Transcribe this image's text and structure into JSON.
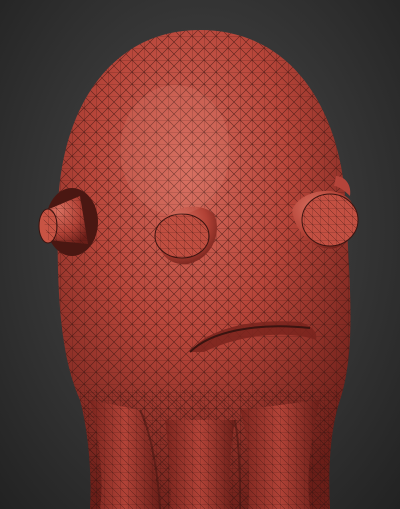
{
  "viewport": {
    "background": "#3a3a3a",
    "model": {
      "name": "creature-mesh",
      "shading": "wireframe-on-shaded",
      "surface_color": "#b8463a",
      "wire_color": "#3a1410"
    }
  }
}
